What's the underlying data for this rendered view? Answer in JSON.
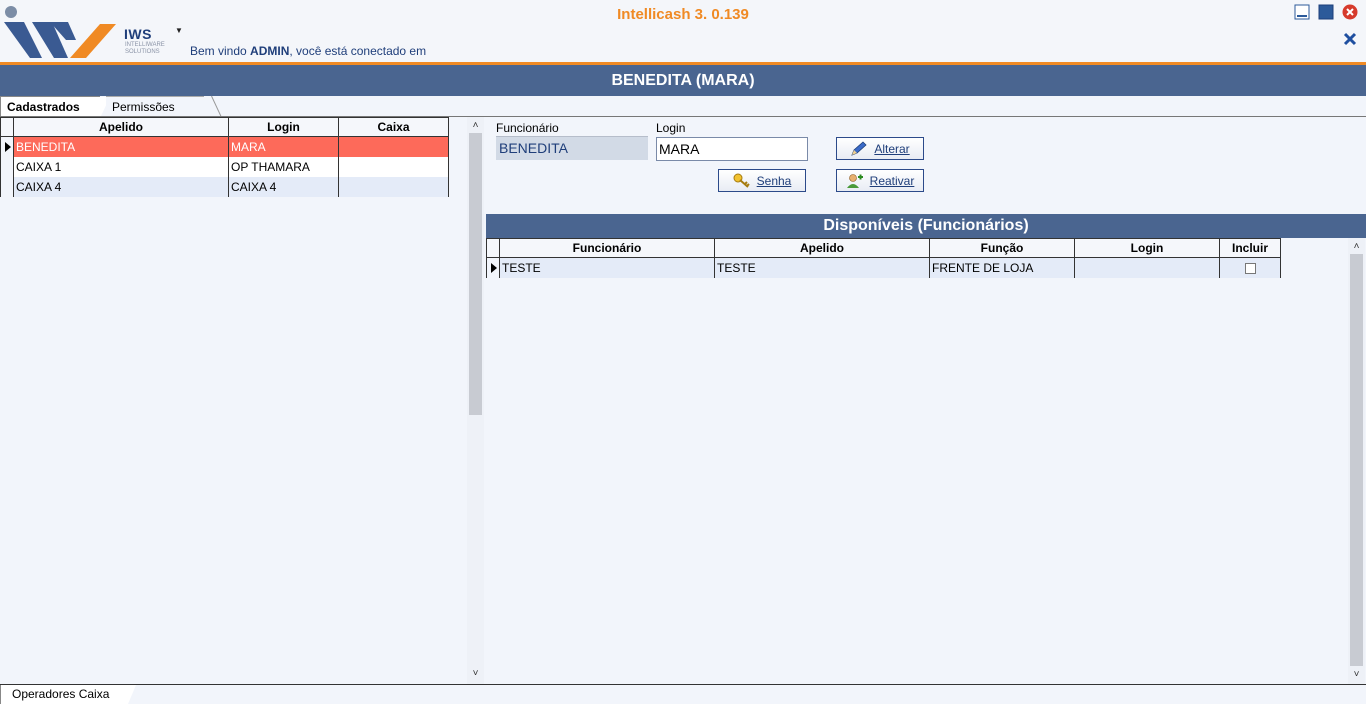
{
  "app": {
    "title": "Intellicash 3. 0.139",
    "logo_text": "IWS",
    "logo_subtext": "INTELLIWARE SOLUTIONS",
    "welcome_prefix": "Bem vindo ",
    "welcome_user": "ADMIN",
    "welcome_suffix": ", você está conectado em"
  },
  "page": {
    "title": "BENEDITA (MARA)"
  },
  "tabs": [
    {
      "label": "Cadastrados",
      "active": true
    },
    {
      "label": "Permissões",
      "active": false
    }
  ],
  "left_grid": {
    "columns": [
      "Apelido",
      "Login",
      "Caixa"
    ],
    "rows": [
      {
        "apelido": "BENEDITA",
        "login": "MARA",
        "caixa": ""
      },
      {
        "apelido": "CAIXA 1",
        "login": "OP THAMARA",
        "caixa": ""
      },
      {
        "apelido": "CAIXA 4",
        "login": "CAIXA 4",
        "caixa": ""
      }
    ]
  },
  "form": {
    "funcionario_label": "Funcionário",
    "funcionario_value": "BENEDITA",
    "login_label": "Login",
    "login_value": "MARA",
    "alterar_label": "Alterar",
    "senha_label": "Senha",
    "reativar_label": "Reativar"
  },
  "disponiveis": {
    "title": "Disponíveis (Funcionários)",
    "columns": [
      "Funcionário",
      "Apelido",
      "Função",
      "Login",
      "Incluir"
    ],
    "rows": [
      {
        "funcionario": "TESTE",
        "apelido": "TESTE",
        "funcao": "FRENTE DE LOJA",
        "login": "",
        "incluir": false
      }
    ]
  },
  "bottom_tab": {
    "label": "Operadores Caixa"
  },
  "colors": {
    "accent_orange": "#f08a24",
    "header_blue": "#4a6590",
    "selected_row": "#fd6a5a"
  }
}
